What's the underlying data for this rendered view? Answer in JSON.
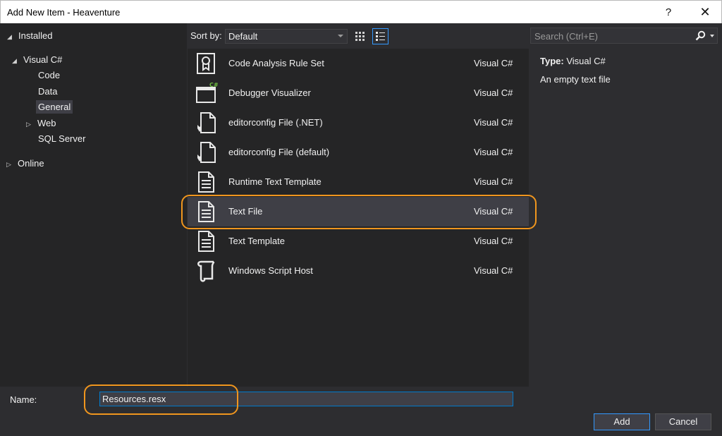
{
  "window": {
    "title": "Add New Item - Heaventure",
    "help": "?",
    "close": "✕"
  },
  "nav": {
    "installed": "Installed",
    "visual_csharp": "Visual C#",
    "children": [
      "Code",
      "Data",
      "General",
      "Web",
      "SQL Server"
    ],
    "selected": "General",
    "online": "Online"
  },
  "toolbar": {
    "sort_label": "Sort by:",
    "sort_value": "Default"
  },
  "search": {
    "placeholder": "Search (Ctrl+E)"
  },
  "items": [
    {
      "name": "Code Analysis Rule Set",
      "lang": "Visual C#",
      "icon": "rule-set-icon"
    },
    {
      "name": "Debugger Visualizer",
      "lang": "Visual C#",
      "icon": "debugger-visualizer-icon"
    },
    {
      "name": "editorconfig File (.NET)",
      "lang": "Visual C#",
      "icon": "editorconfig-icon"
    },
    {
      "name": "editorconfig File (default)",
      "lang": "Visual C#",
      "icon": "editorconfig-icon"
    },
    {
      "name": "Runtime Text Template",
      "lang": "Visual C#",
      "icon": "text-file-icon"
    },
    {
      "name": "Text File",
      "lang": "Visual C#",
      "icon": "text-file-icon"
    },
    {
      "name": "Text Template",
      "lang": "Visual C#",
      "icon": "text-file-icon"
    },
    {
      "name": "Windows Script Host",
      "lang": "Visual C#",
      "icon": "script-icon"
    }
  ],
  "selected_item": "Text File",
  "details": {
    "type_label": "Type:",
    "type_value": "Visual C#",
    "description": "An empty text file"
  },
  "bottom": {
    "name_label": "Name:",
    "name_value": "Resources.resx",
    "add_label": "Add",
    "cancel_label": "Cancel"
  },
  "colors": {
    "accent": "#3399ff",
    "highlight": "#f0961e"
  }
}
